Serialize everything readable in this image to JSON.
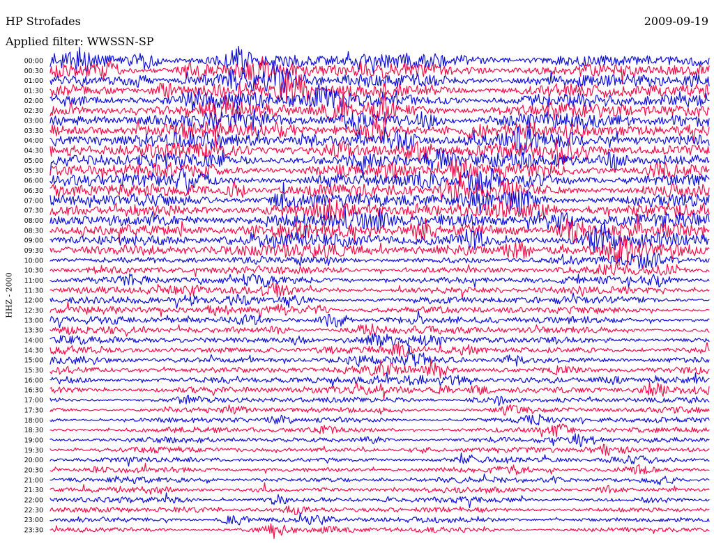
{
  "header": {
    "station": "HP Strofades",
    "date": "2009-09-19",
    "filter": "Applied filter: WWSSN-SP"
  },
  "axis": {
    "channel_label": "HHZ - 2000"
  },
  "colors": {
    "trace_a": "#1010d8",
    "trace_b": "#f0104a",
    "background": "#ffffff",
    "text": "#000000"
  },
  "chart_data": {
    "type": "line",
    "title": "",
    "xlabel": "",
    "ylabel": "HHZ - 2000",
    "rows": [
      "00:00",
      "00:30",
      "01:00",
      "01:30",
      "02:00",
      "02:30",
      "03:00",
      "03:30",
      "04:00",
      "04:30",
      "05:00",
      "05:30",
      "06:00",
      "06:30",
      "07:00",
      "07:30",
      "08:00",
      "08:30",
      "09:00",
      "09:30",
      "10:00",
      "10:30",
      "11:00",
      "11:30",
      "12:00",
      "12:30",
      "13:00",
      "13:30",
      "14:00",
      "14:30",
      "15:00",
      "15:30",
      "16:00",
      "16:30",
      "17:00",
      "17:30",
      "18:00",
      "18:30",
      "19:00",
      "19:30",
      "20:00",
      "20:30",
      "21:00",
      "21:30",
      "22:00",
      "22:30",
      "23:00",
      "23:30"
    ],
    "series_colors": [
      "#1010d8",
      "#f0104a"
    ],
    "color_pattern": "alternating",
    "grid": false,
    "legend": "none"
  }
}
